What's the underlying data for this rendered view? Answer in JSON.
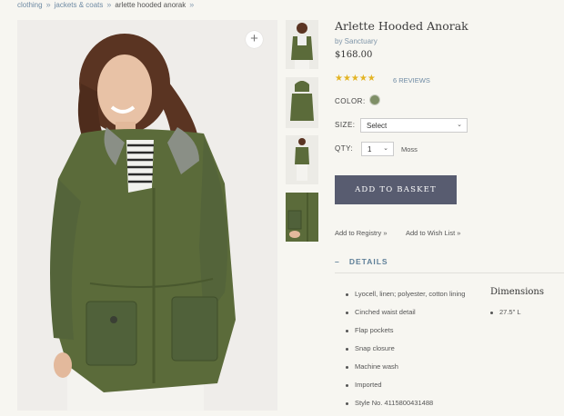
{
  "breadcrumb": [
    "clothing",
    "jackets & coats",
    "arlette hooded anorak"
  ],
  "breadcrumb_sep": "»",
  "product": {
    "title": "Arlette Hooded Anorak",
    "brand": "by Sanctuary",
    "price": "$168.00",
    "stars": "★★★★★",
    "reviews": "6 REVIEWS",
    "color_label": "COLOR:",
    "color_swatch": "#7f8f67",
    "size_label": "SIZE:",
    "size_value": "Select",
    "qty_label": "QTY:",
    "qty_value": "1",
    "color_name": "Moss",
    "add_button": "ADD TO BASKET",
    "registry_link": "Add to Registry »",
    "wishlist_link": "Add to Wish List »"
  },
  "details": {
    "toggle": "–",
    "heading": "DETAILS",
    "items": [
      "Lyocell, linen; polyester, cotton lining",
      "Cinched waist detail",
      "Flap pockets",
      "Snap closure",
      "Machine wash",
      "Imported",
      "Style No. 4115800431488"
    ],
    "dimensions_heading": "Dimensions",
    "dimensions_value": "27.5\" L"
  },
  "zoom_icon": "plus-icon",
  "colors": {
    "accent": "#585c70",
    "link": "#6f8ba4",
    "jacket": "#5b6b3a"
  }
}
